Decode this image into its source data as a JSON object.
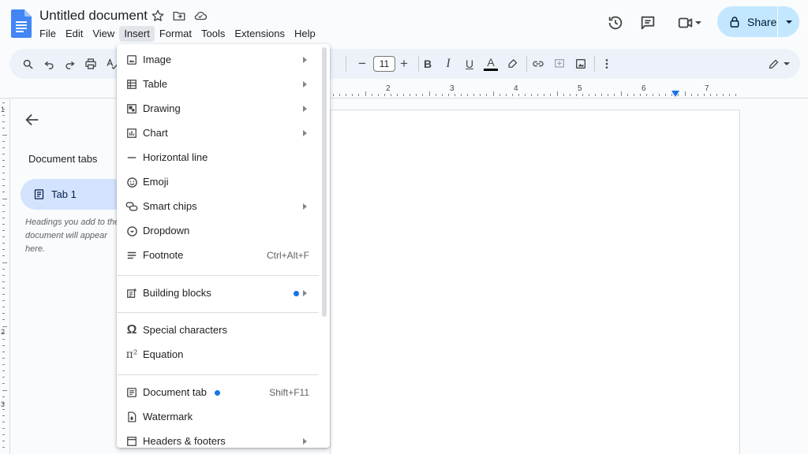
{
  "app": {
    "doc_title": "Untitled document",
    "menus": [
      "File",
      "Edit",
      "View",
      "Insert",
      "Format",
      "Tools",
      "Extensions",
      "Help"
    ],
    "active_menu": "Insert",
    "share_label": "Share",
    "accent_color": "#1a73e8",
    "share_bg": "#c2e7ff"
  },
  "toolbar": {
    "font_size": "11",
    "icons": [
      "search-icon",
      "undo-icon",
      "redo-icon",
      "print-icon",
      "spellcheck-icon",
      "decrease-font-icon",
      "increase-font-icon",
      "bold-icon",
      "italic-icon",
      "underline-icon",
      "text-color-icon",
      "highlight-icon",
      "link-icon",
      "comment-icon",
      "image-icon",
      "more-icon",
      "edit-mode-icon"
    ],
    "bold_glyph": "B",
    "italic_glyph": "I",
    "underline_glyph": "U",
    "text_color_glyph": "A",
    "minus_glyph": "−",
    "plus_glyph": "+"
  },
  "ruler": {
    "numbers": [
      "2",
      "3",
      "4",
      "5",
      "6",
      "7"
    ]
  },
  "vruler": {
    "numbers": [
      "1",
      "2",
      "3"
    ]
  },
  "sidebar": {
    "title": "Document tabs",
    "tab_label": "Tab 1",
    "hint": "Headings you add to the document will appear here."
  },
  "insert_menu": {
    "items": [
      {
        "label": "Image",
        "icon": "image-icon",
        "submenu": true
      },
      {
        "label": "Table",
        "icon": "table-icon",
        "submenu": true
      },
      {
        "label": "Drawing",
        "icon": "drawing-icon",
        "submenu": true
      },
      {
        "label": "Chart",
        "icon": "chart-icon",
        "submenu": true
      },
      {
        "label": "Horizontal line",
        "icon": "horizontal-line-icon",
        "submenu": false
      },
      {
        "label": "Emoji",
        "icon": "emoji-icon",
        "submenu": false
      },
      {
        "label": "Smart chips",
        "icon": "smart-chips-icon",
        "submenu": true
      },
      {
        "label": "Dropdown",
        "icon": "dropdown-icon",
        "submenu": false
      },
      {
        "label": "Footnote",
        "icon": "footnote-icon",
        "shortcut": "Ctrl+Alt+F"
      },
      {
        "label": "Building blocks",
        "icon": "building-blocks-icon",
        "submenu": true,
        "new_dot": true
      },
      {
        "label": "Special characters",
        "icon": "omega-icon",
        "submenu": false
      },
      {
        "label": "Equation",
        "icon": "pi-icon",
        "submenu": false
      },
      {
        "label": "Document tab",
        "icon": "document-tab-icon",
        "shortcut": "Shift+F11",
        "new_dot": true
      },
      {
        "label": "Watermark",
        "icon": "watermark-icon",
        "submenu": false
      },
      {
        "label": "Headers & footers",
        "icon": "headers-footers-icon",
        "submenu": true
      }
    ],
    "omega_glyph": "Ω",
    "pi_glyph": "π²"
  }
}
